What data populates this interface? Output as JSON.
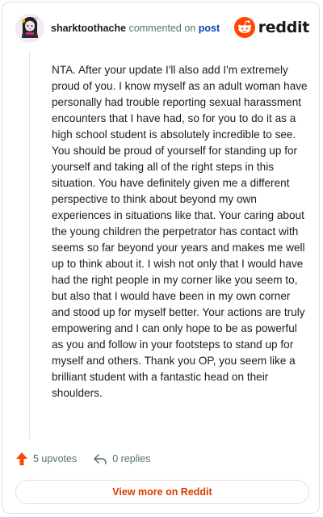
{
  "header": {
    "username": "sharktoothache",
    "action_text": " commented on ",
    "post_link": "post",
    "brand": "reddit"
  },
  "comment": {
    "text": "NTA. After your update I'll also add I'm extremely proud of you. I know myself as an adult woman have personally had trouble reporting sexual harassment encounters that I have had, so for you to do it as a high school student is absolutely incredible to see. You should be proud of yourself for standing up for yourself and taking all of the right steps in this situation. You have definitely given me a different perspective to think about beyond my own experiences in situations like that. Your caring about the young children the perpetrator has contact with seems so far beyond your years and makes me well up to think about it. I wish not only that I would have had the right people in my corner like you seem to, but also that I would have been in my own corner and stood up for myself better. Your actions are truly empowering and I can only hope to be as powerful as you and follow in your footsteps to stand up for myself and others. Thank you OP, you seem like a brilliant student with a fantastic head on their shoulders."
  },
  "actions": {
    "upvotes": "5 upvotes",
    "replies": "0 replies"
  },
  "footer": {
    "view_more": "View more on Reddit"
  },
  "icons": {
    "avatar": "user-avatar-icon",
    "brand_logo": "reddit-logo-icon",
    "upvote": "upvote-arrow-icon",
    "reply": "reply-arrow-icon"
  },
  "colors": {
    "brand_orange": "#ff4500",
    "link_blue": "#0045ac",
    "view_more_text": "#d93a00",
    "meta_gray": "#576f76"
  }
}
